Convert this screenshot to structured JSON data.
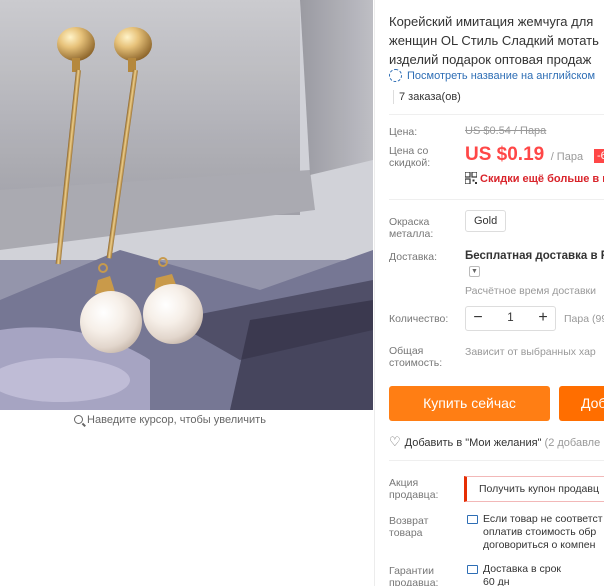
{
  "product": {
    "title_lines": [
      "Корейский имитация жемчуга для",
      "женщин OL Стиль Сладкий мотать",
      "изделий подарок оптовая продаж"
    ],
    "translate_link": "Посмотреть название на английском",
    "orders": "7 заказа(ов)"
  },
  "gallery": {
    "zoom_hint": "Наведите курсор, чтобы увеличить"
  },
  "price": {
    "label": "Цена:",
    "old": "US $0.54 / Пара",
    "discount_label": "Цена со скидкой:",
    "current": "US $0.19",
    "unit": "/ Пара",
    "badge": "-6",
    "app_discount": "Скидки ещё больше в п"
  },
  "options": {
    "metal_color_label": "Окраска металла:",
    "metal_color_value": "Gold"
  },
  "shipping": {
    "label": "Доставка:",
    "method": "Бесплатная доставка в Ru",
    "estimate": "Расчётное время доставки"
  },
  "quantity": {
    "label": "Количество:",
    "value": "1",
    "minus": "−",
    "plus": "+",
    "available": "Пара (99"
  },
  "total": {
    "label": "Общая стоимость:",
    "note": "Зависит от выбранных хар"
  },
  "actions": {
    "buy_now": "Купить сейчас",
    "add_to_cart": "Доб",
    "wishlist": "Добавить в \"Мои желания\"",
    "wishlist_count": "(2 добавле"
  },
  "promo": {
    "label": "Акция продавца:",
    "coupon": "Получить купон продавц"
  },
  "returns": {
    "label": "Возврат товара",
    "lines": [
      "Если товар не соответст",
      "оплатив стоимость обр",
      "договориться о компен"
    ]
  },
  "guarantee": {
    "label": "Гарантии продавца:",
    "lines": [
      "Доставка в срок",
      "60 дн"
    ]
  },
  "colors": {
    "price_red": "#ff4747",
    "buy_orange": "#ff7e14",
    "cart_orange": "#ff6e00",
    "link_blue": "#2e6eb5",
    "app_red": "#d9242b"
  }
}
